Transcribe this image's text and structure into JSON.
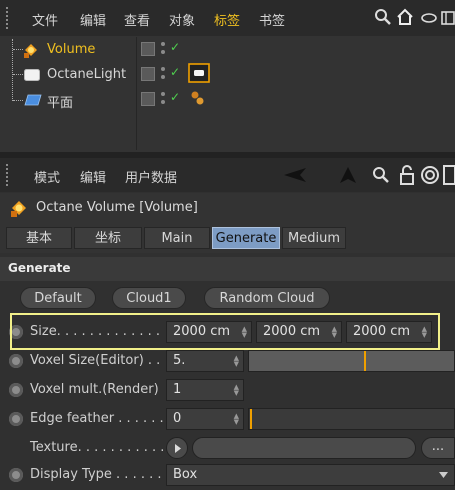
{
  "object_manager": {
    "menu": [
      "文件",
      "编辑",
      "查看",
      "对象",
      "标签",
      "书签"
    ],
    "active_menu_index": 4,
    "toolbar_icons": [
      "search-icon",
      "home-icon",
      "view-icon",
      "layout-icon"
    ],
    "objects": [
      {
        "name": "Volume",
        "selected": true,
        "icon": "octane-volume-icon",
        "has_tag": false
      },
      {
        "name": "OctaneLight",
        "selected": false,
        "icon": "octane-light-icon",
        "has_tag": true
      },
      {
        "name": "平面",
        "selected": false,
        "icon": "plane-icon",
        "has_tag": false
      }
    ]
  },
  "attribute_manager": {
    "menu": [
      "模式",
      "编辑",
      "用户数据"
    ],
    "object_title": "Octane Volume [Volume]",
    "tabs": [
      "基本",
      "坐标",
      "Main",
      "Generate",
      "Medium"
    ],
    "selected_tab_index": 3,
    "section_title": "Generate",
    "preset_buttons": [
      "Default",
      "Cloud1",
      "Random Cloud"
    ],
    "params": {
      "size": {
        "label": "Size. . . . . . . . . . . . .",
        "values": [
          "2000 cm",
          "2000 cm",
          "2000 cm"
        ]
      },
      "voxel_size": {
        "label": "Voxel Size(Editor) . .",
        "value": "5."
      },
      "voxel_mult": {
        "label": "Voxel mult.(Render)",
        "value": "1"
      },
      "edge_feather": {
        "label": "Edge feather . . . . . .",
        "value": "0"
      },
      "texture": {
        "label": "Texture. . . . . . . . . . .",
        "more": "..."
      },
      "display_type": {
        "label": "Display Type . . . . . .",
        "value": "Box"
      }
    }
  },
  "colors": {
    "active_menu": "#f0c020",
    "selected_tab": "#7d9cc4",
    "highlight_frame": "#f2f08a",
    "slider_marker": "#f0a000",
    "check": "#4fd04f"
  }
}
